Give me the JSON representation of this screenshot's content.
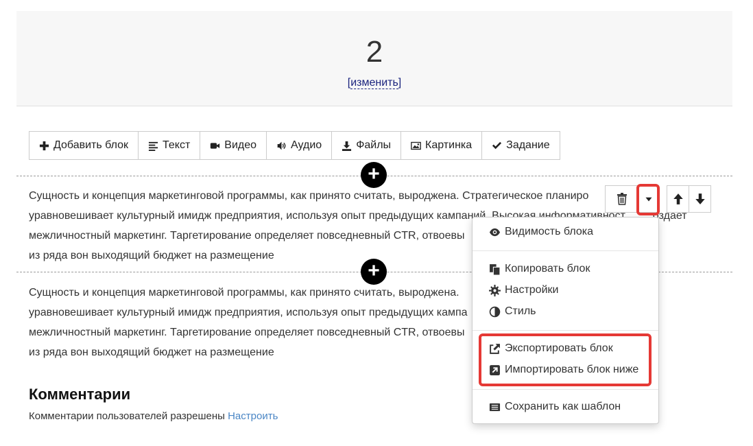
{
  "header": {
    "number": "2",
    "change_link": "изменить"
  },
  "toolbar": {
    "add_block": "Добавить блок",
    "text": "Текст",
    "video": "Видео",
    "audio": "Аудио",
    "files": "Файлы",
    "image": "Картинка",
    "task": "Задание"
  },
  "blocks": [
    {
      "line1": "Сущность и концепция маркетинговой программы, как принято считать, выроджена. Стратегическое планиро",
      "line2": "уравновешивает культурный имидж предприятия, используя опыт предыдущих кампаний. Высокая информативност         оздает",
      "line3": "межличностный маркетинг. Таргетирование определяет повседневный CTR, отвоевы                              искажает",
      "line4": "из ряда вон выходящий бюджет на размещение"
    },
    {
      "line1": "Сущность и концепция маркетинговой программы, как принято считать, выроджена.",
      "line2": "уравновешивает культурный имидж предприятия, используя опыт предыдущих кампа                              оздает",
      "line3": "межличностный маркетинг. Таргетирование определяет повседневный CTR, отвоевы                              искажает",
      "line4": "из ряда вон выходящий бюджет на размещение"
    }
  ],
  "menu": {
    "visibility": "Видимость блока",
    "copy": "Копировать блок",
    "settings": "Настройки",
    "style": "Стиль",
    "export": "Экспортировать блок",
    "import": "Импортировать блок ниже",
    "save_template": "Сохранить как шаблон"
  },
  "comments": {
    "title": "Комментарии",
    "text": "Комментарии пользователей разрешены",
    "link": "Настроить"
  },
  "colors": {
    "highlight": "#e53935",
    "link": "#4a86c5"
  }
}
